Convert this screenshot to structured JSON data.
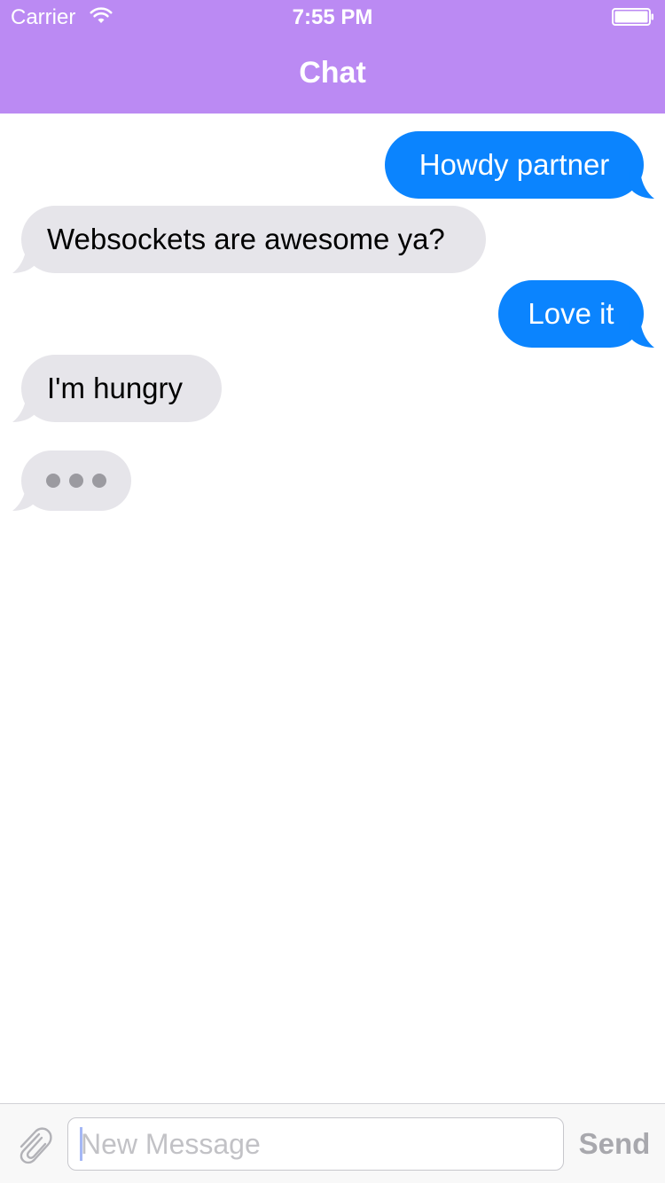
{
  "status_bar": {
    "carrier": "Carrier",
    "time": "7:55 PM"
  },
  "nav": {
    "title": "Chat"
  },
  "colors": {
    "nav_background": "#bb8af3",
    "outgoing_bubble": "#0b84fe",
    "incoming_bubble": "#e6e5ea",
    "send_disabled": "#a8a8ad"
  },
  "messages": [
    {
      "direction": "outgoing",
      "text": "Howdy partner"
    },
    {
      "direction": "incoming",
      "text": "Websockets are awesome ya?"
    },
    {
      "direction": "outgoing",
      "text": "Love it"
    },
    {
      "direction": "incoming",
      "text": "I'm hungry"
    }
  ],
  "typing_indicator": {
    "visible": true,
    "icon": "typing-dots-icon"
  },
  "composer": {
    "attach_icon": "paperclip-icon",
    "placeholder": "New Message",
    "value": "",
    "send_label": "Send"
  }
}
